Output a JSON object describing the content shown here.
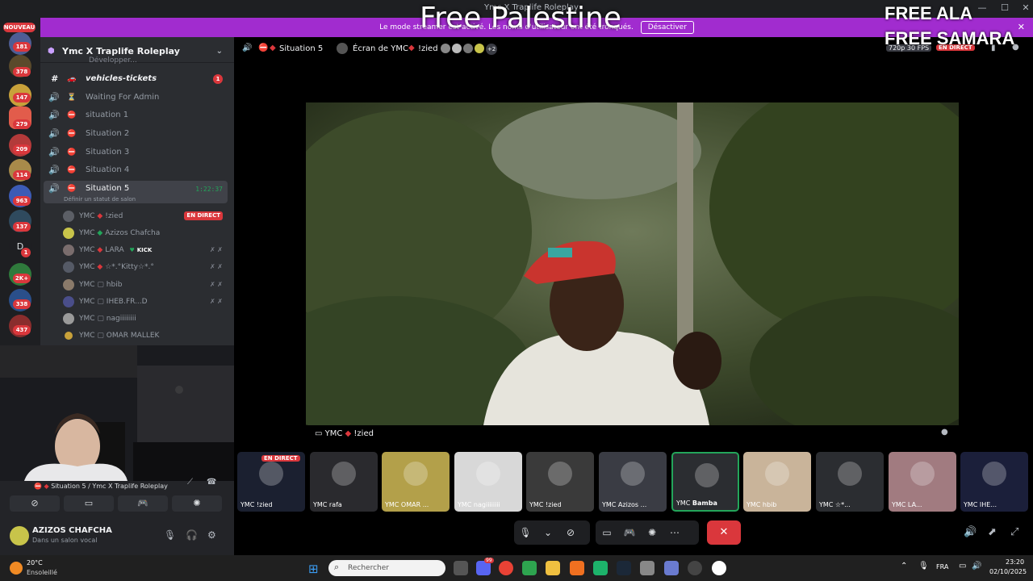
{
  "window": {
    "title": "Ymc X Traplife Roleplay"
  },
  "overlay": {
    "title": "Free Palestine",
    "free_ala": "FREE ALA",
    "free_samara": "FREE SAMARA"
  },
  "banner": {
    "text": "Le mode streamer est activé. Les noms d'utilisateur ont été tronqués.",
    "button": "Désactiver"
  },
  "servers": {
    "nouveau_label": "NOUVEAU",
    "badges": [
      "181",
      "378",
      "147",
      "279",
      "209",
      "114",
      "963",
      "137",
      "D",
      "1",
      "2K+",
      "338",
      "437"
    ]
  },
  "sidebar": {
    "server_name": "Ymc X Traplife Roleplay",
    "partial_channel": "Développer...",
    "channels": [
      {
        "name": "vehicles-tickets",
        "badge": "1"
      },
      {
        "name": "Waiting For Admin"
      },
      {
        "name": "situation 1"
      },
      {
        "name": "Situation 2"
      },
      {
        "name": "Situation 3"
      },
      {
        "name": "Situation 4"
      }
    ],
    "active_channel": {
      "name": "Situation 5",
      "timer": "1:22:37",
      "status_hint": "Définir un statut de salon"
    },
    "users": [
      {
        "prefix": "YMC",
        "name": "!zied",
        "live": "EN DIRECT"
      },
      {
        "prefix": "YMC",
        "name": "Azizos Chafcha"
      },
      {
        "prefix": "YMC",
        "name": "LARA",
        "tag": "KICK"
      },
      {
        "prefix": "YMC",
        "name": "☆*.°Kitty☆*.°"
      },
      {
        "prefix": "YMC",
        "name": "hbib"
      },
      {
        "prefix": "YMC",
        "name": "IHEB.FR...D"
      },
      {
        "prefix": "YMC",
        "name": "nagiiiiiiii"
      },
      {
        "prefix": "YMC",
        "name": "OMAR MALLEK"
      }
    ]
  },
  "voice_panel": {
    "connection": "Situation 5 / Ymc X Traplife Roleplay",
    "username": "AZIZOS CHAFCHA",
    "status": "Dans un salon vocal"
  },
  "main_header": {
    "channel": "Situation 5",
    "screen": "Écran de YMC",
    "streamer": "!zied",
    "extra_count": "+2",
    "quality": "720p 30 FPS",
    "live": "EN DIRECT"
  },
  "stream_label": {
    "prefix": "YMC",
    "name": "!zied"
  },
  "tiles": [
    {
      "prefix": "YMC",
      "name": "!zied",
      "live": "EN DIRECT"
    },
    {
      "prefix": "YMC",
      "name": "rafa"
    },
    {
      "prefix": "YMC",
      "name": "OMAR ..."
    },
    {
      "prefix": "YMC",
      "name": "nagiiiiiiii"
    },
    {
      "prefix": "YMC",
      "name": "!zied"
    },
    {
      "prefix": "YMC",
      "name": "Azizos ..."
    },
    {
      "prefix": "YMC",
      "name": "Bamba"
    },
    {
      "prefix": "YMC",
      "name": "hbib"
    },
    {
      "prefix": "YMC",
      "name": "☆*..."
    },
    {
      "prefix": "YMC",
      "name": "LA..."
    },
    {
      "prefix": "YMC",
      "name": "IHE..."
    }
  ],
  "taskbar": {
    "weather_temp": "20°C",
    "weather_desc": "Ensoleillé",
    "search_placeholder": "Rechercher",
    "lang": "FRA",
    "time": "23:20",
    "date": "02/10/2025",
    "notif_badge": "99"
  },
  "colors": {
    "accent": "#5865f2",
    "banner": "#a12ccf",
    "live": "#da373c",
    "online": "#23a55a",
    "end_call": "#da373c"
  }
}
